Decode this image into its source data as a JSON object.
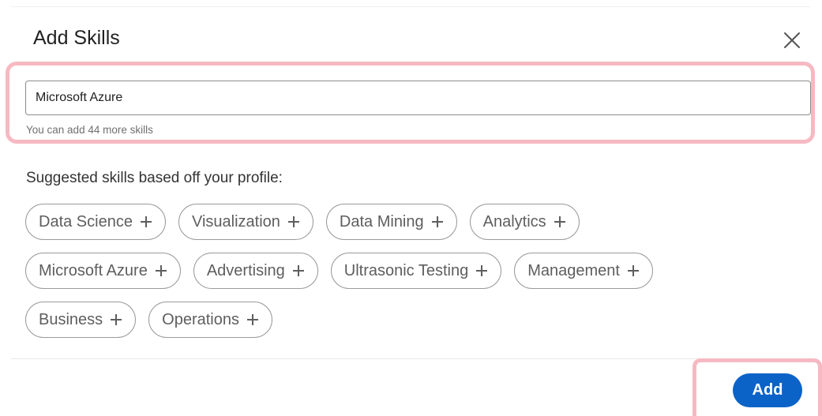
{
  "modal": {
    "title": "Add Skills",
    "close_label": "Close"
  },
  "skill_input": {
    "value": "Microsoft Azure",
    "helper": "You can add 44 more skills"
  },
  "suggestions": {
    "heading": "Suggested skills based off your profile:",
    "rows": [
      [
        "Data Science",
        "Visualization",
        "Data Mining",
        "Analytics"
      ],
      [
        "Microsoft Azure",
        "Advertising",
        "Ultrasonic Testing",
        "Management"
      ],
      [
        "Business",
        "Operations"
      ]
    ]
  },
  "footer": {
    "add_label": "Add"
  },
  "colors": {
    "primary": "#0b63c8",
    "highlight": "#f6b9c2",
    "chip_border": "#9a9a9a",
    "chip_text": "#5e5e5e"
  },
  "icons": {
    "close": "close-icon",
    "chip_add": "plus-icon"
  }
}
